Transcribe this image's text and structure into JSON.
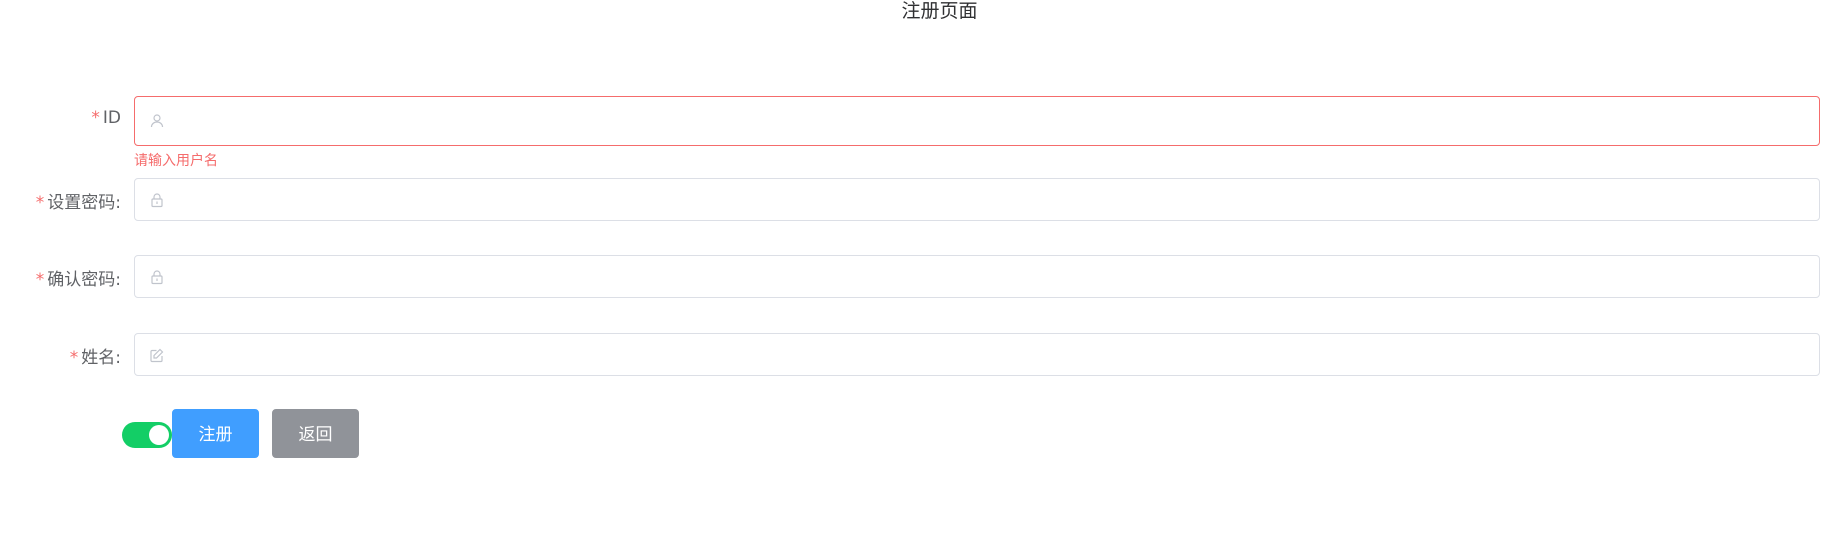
{
  "page": {
    "title": "注册页面"
  },
  "form": {
    "fields": [
      {
        "label": "ID",
        "required_mark": "*",
        "value": "",
        "placeholder": "",
        "icon": "user-icon",
        "error": "请输入用户名"
      },
      {
        "label": "设置密码:",
        "required_mark": "*",
        "value": "",
        "placeholder": "",
        "icon": "lock-icon"
      },
      {
        "label": "确认密码:",
        "required_mark": "*",
        "value": "",
        "placeholder": "",
        "icon": "lock-icon"
      },
      {
        "label": "姓名:",
        "required_mark": "*",
        "value": "",
        "placeholder": "",
        "icon": "edit-icon"
      }
    ]
  },
  "actions": {
    "toggle": {
      "on": true
    },
    "register_label": "注册",
    "back_label": "返回"
  },
  "colors": {
    "primary": "#409eff",
    "info": "#909399",
    "danger": "#f56c6c",
    "switch_on": "#13ce66"
  }
}
